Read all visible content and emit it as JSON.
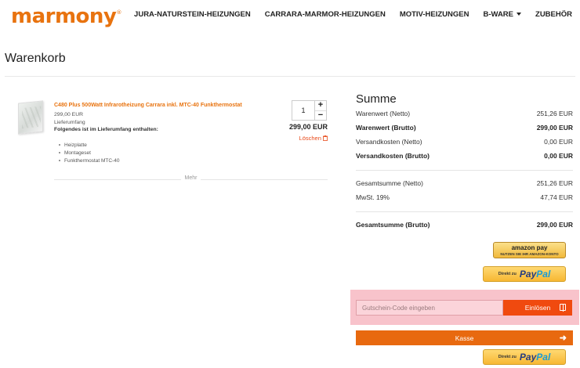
{
  "header": {
    "logo": "marmony",
    "logo_mark": "®",
    "nav": [
      "JURA-NATURSTEIN-HEIZUNGEN",
      "CARRARA-MARMOR-HEIZUNGEN",
      "MOTIV-HEIZUNGEN",
      "B-WARE",
      "ZUBEHÖR"
    ]
  },
  "page_title": "Warenkorb",
  "cart": {
    "item": {
      "name": "C480 Plus 500Watt Infrarotheizung Carrara inkl. MTC-40 Funkthermostat",
      "unit_price": "299,00 EUR",
      "scope_label": "Lieferumfang",
      "included_label": "Folgendes ist im Lieferumfang enthalten:",
      "included": [
        "Heizplatte",
        "Montageset",
        "Funkthermostat MTC-40"
      ],
      "quantity": "1",
      "qty_plus": "+",
      "qty_minus": "−",
      "total": "299,00 EUR",
      "delete_label": "Löschen"
    },
    "more_label": "Mehr"
  },
  "summary": {
    "title": "Summe",
    "rows": [
      {
        "label": "Warenwert (Netto)",
        "value": "251,26 EUR"
      },
      {
        "label": "Warenwert (Brutto)",
        "value": "299,00 EUR"
      },
      {
        "label": "Versandkosten (Netto)",
        "value": "0,00 EUR"
      },
      {
        "label": "Versandkosten (Brutto)",
        "value": "0,00 EUR"
      },
      {
        "label": "Gesamtsumme (Netto)",
        "value": "251,26 EUR"
      },
      {
        "label": "MwSt. 19%",
        "value": "47,74 EUR"
      },
      {
        "label": "Gesamtsumme (Brutto)",
        "value": "299,00 EUR"
      }
    ]
  },
  "payment": {
    "amazon_label": "amazon pay",
    "amazon_sub": "NUTZEN SIE IHR AMAZON-KONTO",
    "paypal_direct": "Direkt zu",
    "paypal_pay": "Pay",
    "paypal_pal": "Pal"
  },
  "coupon": {
    "placeholder": "Gutschein-Code eingeben",
    "button": "Einlösen"
  },
  "checkout": {
    "label": "Kasse",
    "arrow": "➜"
  },
  "colors": {
    "brand": "#e8730f",
    "button": "#f04a0f"
  }
}
